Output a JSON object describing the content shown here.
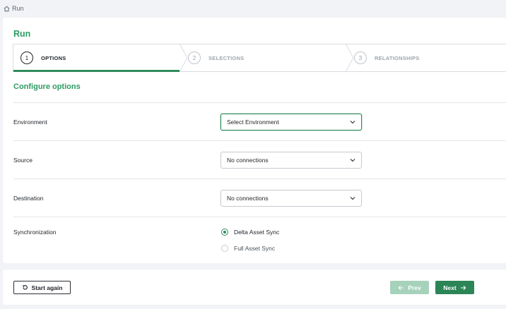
{
  "breadcrumb": {
    "label": "Run",
    "icon": "home-icon"
  },
  "page": {
    "title": "Run"
  },
  "stepper": {
    "steps": [
      {
        "number": "1",
        "label": "OPTIONS",
        "state": "active"
      },
      {
        "number": "2",
        "label": "SELECTIONS",
        "state": "inactive"
      },
      {
        "number": "3",
        "label": "RELATIONSHIPS",
        "state": "inactive"
      }
    ]
  },
  "form": {
    "title": "Configure options",
    "environment": {
      "label": "Environment",
      "value": "Select Environment"
    },
    "source": {
      "label": "Source",
      "value": "No connections"
    },
    "destination": {
      "label": "Destination",
      "value": "No connections"
    },
    "synchronization": {
      "label": "Synchronization",
      "options": [
        {
          "label": "Delta Asset Sync",
          "checked": true
        },
        {
          "label": "Full Asset Sync",
          "checked": false
        }
      ]
    }
  },
  "footer": {
    "start_again_label": "Start again",
    "prev_label": "Prev",
    "next_label": "Next"
  },
  "colors": {
    "accent": "#2c9b62",
    "button_primary": "#2b8556",
    "button_disabled": "#a6d2bb"
  }
}
